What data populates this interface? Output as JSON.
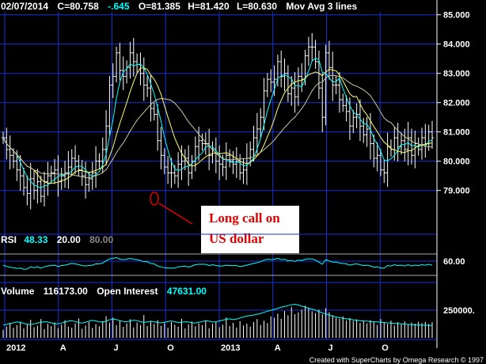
{
  "header": {
    "date": "02/07/2014",
    "close": "C=80.758",
    "change": "-.645",
    "open": "O=81.385",
    "high": "H=81.420",
    "low": "L=80.630",
    "study": "Mov Avg 3 lines"
  },
  "rsi_panel": {
    "label": "RSI",
    "value": "48.33",
    "low_level": "20.00",
    "high_level": "80.00",
    "tick": "60.00"
  },
  "volume_panel": {
    "label": "Volume",
    "volume": "116173.00",
    "oi_label": "Open Interest",
    "oi": "47631.00",
    "tick": "250000."
  },
  "annotation": {
    "line1": "Long call on",
    "line2": "US dollar"
  },
  "credit": "Created with SuperCharts by Omega Research © 1997",
  "colors": {
    "background": "#000000",
    "grid": "#1a2fd6",
    "bars": "#ffffff",
    "ma_fast": "#00ffff",
    "ma_mid": "#ffff66",
    "ma_slow": "#c8c8a0",
    "change": "#00ffff",
    "rsi_line": "#00ffff",
    "oi_line": "#00ffff",
    "annotation": "#e00000",
    "annotation_box": "#ffffff"
  },
  "chart_data": {
    "type": "bar",
    "title": "02/07/2014",
    "y_ticks": [
      "85.000",
      "84.000",
      "83.000",
      "82.000",
      "81.000",
      "80.000",
      "79.000"
    ],
    "ylim": [
      78.1,
      85.1
    ],
    "x_tick_labels": [
      "2012",
      "A",
      "J",
      "O",
      "2013",
      "A",
      "J",
      "O"
    ],
    "series": [
      {
        "name": "price",
        "type": "ohlc",
        "close": [
          80.8,
          80.4,
          80.2,
          80.0,
          79.7,
          79.5,
          79.1,
          78.9,
          79.4,
          79.0,
          79.3,
          78.8,
          79.3,
          79.5,
          79.6,
          79.7,
          79.3,
          79.5,
          79.6,
          79.8,
          80.1,
          80.0,
          79.7,
          79.5,
          79.2,
          79.4,
          79.6,
          80.0,
          80.0,
          80.4,
          81.2,
          82.6,
          82.9,
          83.7,
          83.1,
          82.9,
          83.2,
          83.7,
          83.4,
          83.3,
          83.0,
          82.6,
          82.5,
          81.8,
          81.6,
          80.7,
          80.2,
          79.8,
          79.6,
          79.6,
          79.5,
          79.9,
          80.0,
          80.1,
          79.6,
          80.0,
          80.5,
          80.7,
          80.6,
          80.6,
          80.2,
          80.4,
          80.0,
          79.9,
          79.8,
          80.2,
          80.0,
          79.9,
          80.0,
          79.6,
          79.7,
          80.1,
          80.4,
          80.8,
          81.1,
          81.5,
          82.4,
          82.8,
          82.7,
          82.8,
          83.4,
          82.9,
          83.0,
          82.3,
          82.5,
          82.2,
          82.9,
          82.8,
          83.6,
          83.9,
          83.9,
          83.4,
          82.5,
          81.5,
          83.7,
          83.2,
          82.6,
          82.6,
          82.1,
          81.9,
          81.7,
          81.2,
          81.5,
          81.6,
          81.2,
          80.9,
          81.1,
          80.6,
          80.1,
          80.2,
          79.7,
          79.6,
          80.5,
          80.4,
          80.8,
          80.5,
          80.7,
          80.4,
          80.8,
          80.2,
          80.6,
          80.4,
          80.8,
          80.6,
          81.0,
          80.8
        ]
      }
    ],
    "rsi": [
      48,
      45,
      43,
      42,
      40,
      41,
      38,
      39,
      44,
      42,
      44,
      41,
      44,
      46,
      47,
      48,
      45,
      47,
      48,
      50,
      52,
      51,
      49,
      47,
      46,
      47,
      48,
      51,
      51,
      53,
      58,
      63,
      64,
      66,
      62,
      61,
      62,
      64,
      62,
      61,
      59,
      56,
      56,
      52,
      51,
      46,
      44,
      42,
      41,
      41,
      41,
      44,
      45,
      46,
      43,
      46,
      49,
      50,
      50,
      50,
      47,
      49,
      47,
      46,
      46,
      48,
      47,
      47,
      47,
      45,
      46,
      48,
      50,
      52,
      54,
      56,
      60,
      62,
      61,
      62,
      64,
      61,
      62,
      58,
      59,
      57,
      60,
      59,
      62,
      63,
      63,
      60,
      55,
      50,
      61,
      58,
      55,
      55,
      53,
      52,
      51,
      48,
      50,
      51,
      49,
      47,
      48,
      46,
      43,
      44,
      41,
      41,
      47,
      46,
      49,
      47,
      48,
      46,
      49,
      46,
      48,
      47,
      49,
      48,
      50,
      48
    ],
    "volume": [
      60,
      85,
      110,
      75,
      95,
      120,
      70,
      100,
      135,
      80,
      90,
      140,
      65,
      105,
      88,
      115,
      72,
      98,
      130,
      84,
      76,
      108,
      145,
      68,
      92,
      118,
      74,
      102,
      86,
      125,
      160,
      112,
      150,
      95,
      128,
      82,
      106,
      138,
      78,
      114,
      96,
      170,
      88,
      120,
      104,
      132,
      90,
      110,
      76,
      118,
      98,
      84,
      142,
      70,
      100,
      122,
      86,
      108,
      94,
      130,
      72,
      104,
      116,
      80,
      98,
      152,
      88,
      112,
      76,
      124,
      92,
      106,
      84,
      118,
      140,
      96,
      128,
      110,
      160,
      150,
      180,
      142,
      200,
      168,
      230,
      176,
      190,
      210,
      240,
      225,
      198,
      185,
      210,
      176,
      220,
      190,
      168,
      150,
      142,
      160,
      130,
      148,
      126,
      138,
      112,
      124,
      108,
      132,
      118,
      96,
      140,
      112,
      104,
      128,
      92,
      118,
      100,
      122,
      98,
      114,
      106,
      120,
      110,
      118,
      104,
      116
    ],
    "open_interest": [
      95,
      100,
      108,
      112,
      118,
      115,
      108,
      102,
      98,
      104,
      110,
      116,
      120,
      118,
      112,
      106,
      104,
      110,
      118,
      124,
      128,
      122,
      114,
      110,
      116,
      124,
      130,
      126,
      120,
      118,
      124,
      134,
      142,
      136,
      128,
      122,
      120,
      126,
      132,
      128,
      120,
      116,
      118,
      124,
      120,
      114,
      112,
      116,
      122,
      126,
      120,
      114,
      116,
      120,
      118,
      112,
      110,
      116,
      122,
      128,
      124,
      118,
      120,
      126,
      132,
      138,
      142,
      136,
      140,
      148,
      156,
      162,
      166,
      170,
      176,
      182,
      190,
      198,
      205,
      212,
      220,
      228,
      234,
      240,
      246,
      250,
      244,
      236,
      228,
      220,
      214,
      206,
      196,
      186,
      178,
      170,
      162,
      156,
      150,
      146,
      142,
      138,
      134,
      130,
      128,
      126,
      124,
      122,
      120,
      118,
      116,
      114,
      112,
      110,
      108,
      106,
      104,
      102,
      100,
      98,
      97,
      96,
      95,
      94,
      93,
      92
    ],
    "grid": true
  }
}
